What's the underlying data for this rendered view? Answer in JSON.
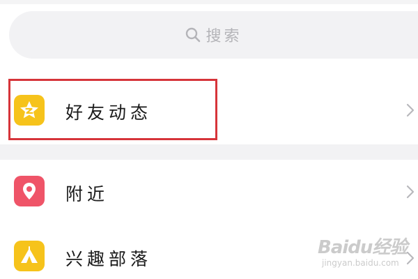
{
  "search": {
    "placeholder": "搜索",
    "icon": "search-icon"
  },
  "rows": [
    {
      "label": "好友动态",
      "icon": "qzone-star-icon",
      "icon_color": "#f6c31b",
      "highlighted": true
    },
    {
      "label": "附近",
      "icon": "location-pin-icon",
      "icon_color": "#ef5468"
    },
    {
      "label": "兴趣部落",
      "icon": "tent-icon",
      "icon_color": "#f6c31b"
    }
  ],
  "colors": {
    "highlight_border": "#d6343a",
    "background_band": "#f2f2f4",
    "chevron": "#b8b8bc"
  },
  "watermark": {
    "brand": "Baidu经验",
    "url": "jingyan.baidu.com"
  }
}
